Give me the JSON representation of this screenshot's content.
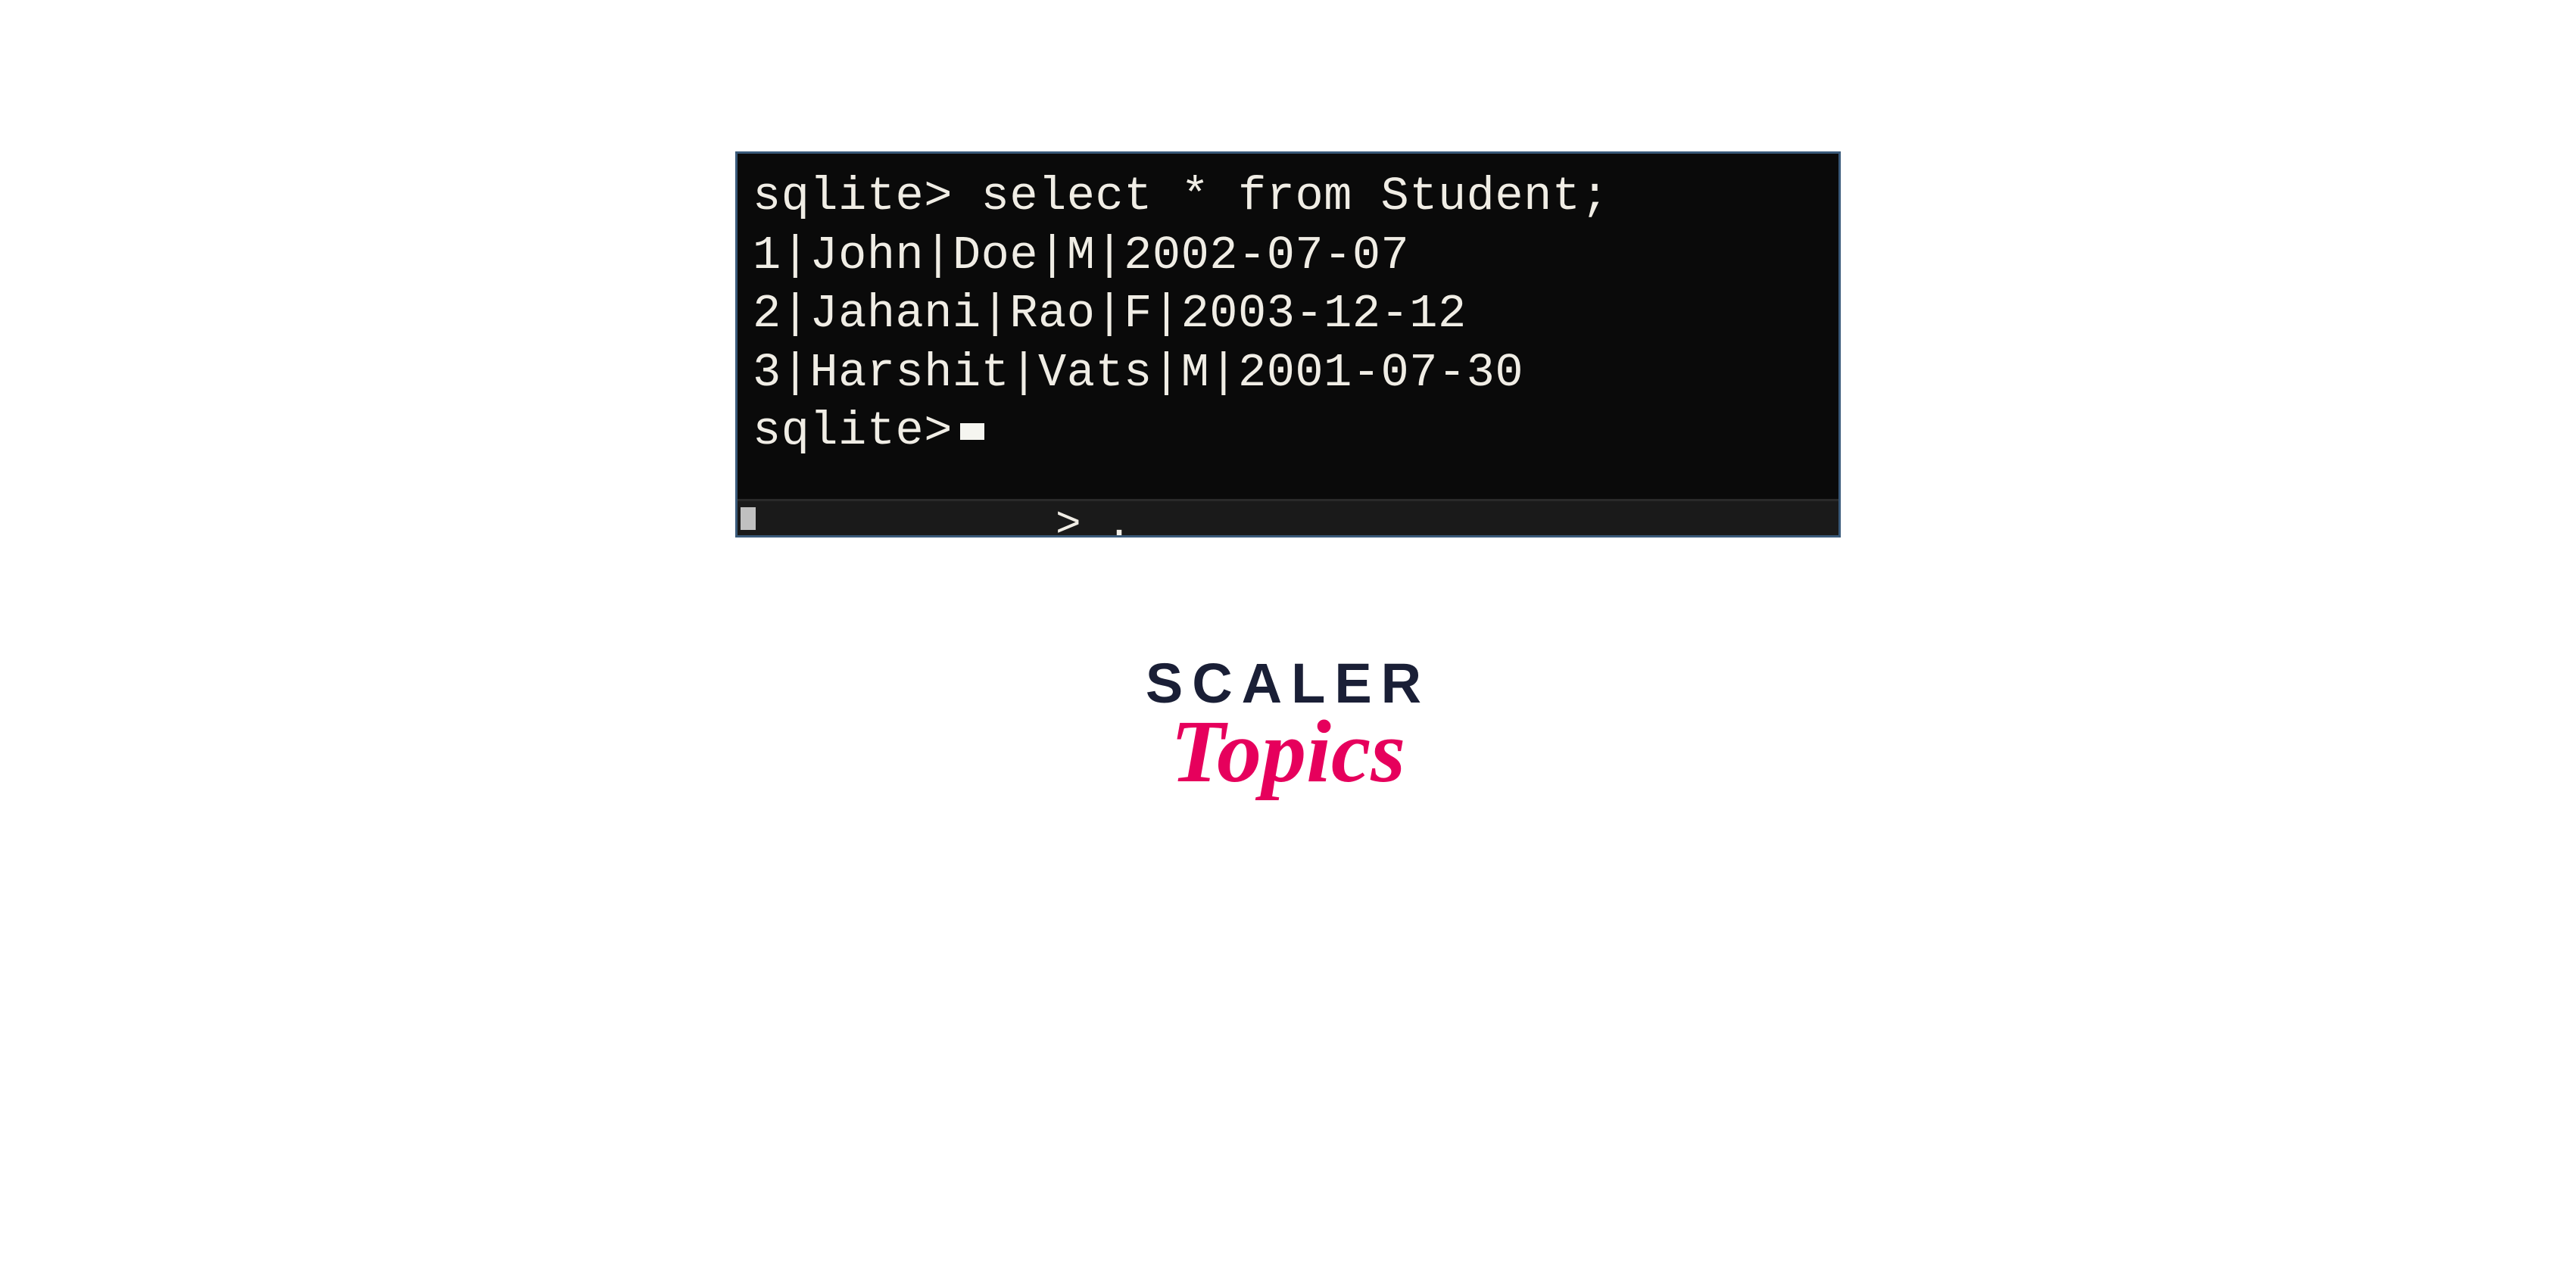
{
  "terminal": {
    "prompt": "sqlite>",
    "command": "select * from Student;",
    "rows": [
      "1|John|Doe|M|2002-07-07",
      "2|Jahani|Rao|F|2003-12-12",
      "3|Harshit|Vats|M|2001-07-30"
    ],
    "prompt2": "sqlite>",
    "faint": ">  ."
  },
  "logo": {
    "line1": "SCALER",
    "line2": "Topics"
  }
}
